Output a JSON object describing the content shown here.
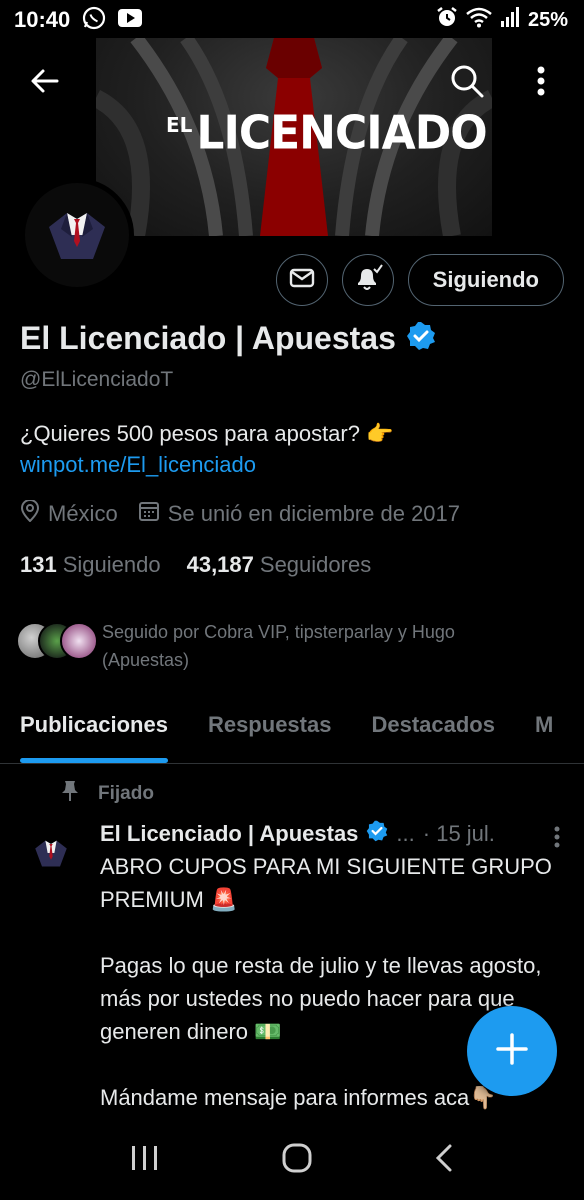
{
  "status_bar": {
    "time": "10:40",
    "battery": "25%",
    "left_icons": [
      "whatsapp-icon",
      "youtube-icon"
    ],
    "right_icons": [
      "alarm-icon",
      "wifi-icon",
      "signal-icon"
    ]
  },
  "banner": {
    "logo_small": "EL",
    "logo_main": "LICENCIADO"
  },
  "header_actions": {
    "back_icon": "arrow-left-icon",
    "search_icon": "search-icon",
    "more_icon": "more-vertical-icon"
  },
  "profile": {
    "name": "El Licenciado | Apuestas",
    "handle": "@ElLicenciadoT",
    "bio": "¿Quieres 500 pesos para apostar? 👉",
    "link": "winpot.me/El_licenciado",
    "location": "México",
    "joined": "Se unió en diciembre de 2017",
    "following_count": "131",
    "following_label": "Siguiendo",
    "followers_count": "43,187",
    "followers_label": "Seguidores",
    "followed_by": "Seguido por Cobra VIP, tipsterparlay y Hugo (Apuestas)"
  },
  "actions": {
    "follow_label": "Siguiendo"
  },
  "tabs": [
    {
      "label": "Publicaciones",
      "active": true
    },
    {
      "label": "Respuestas",
      "active": false
    },
    {
      "label": "Destacados",
      "active": false
    },
    {
      "label": "M",
      "active": false
    }
  ],
  "post": {
    "pinned_label": "Fijado",
    "author": "El Licenciado | Apuestas",
    "ellipsis": "...",
    "date": "· 15 jul.",
    "paragraphs": [
      "ABRO CUPOS PARA MI SIGUIENTE GRUPO PREMIUM 🚨",
      "Pagas lo que resta de julio y te llevas agosto, más por ustedes no puedo hacer para que generen dinero 💵",
      "Mándame mensaje para informes aca👇🏼"
    ]
  },
  "colors": {
    "accent": "#1d9bf0",
    "background": "#000000",
    "text": "#e7e9ea",
    "muted": "#71767b",
    "border": "#536471"
  }
}
